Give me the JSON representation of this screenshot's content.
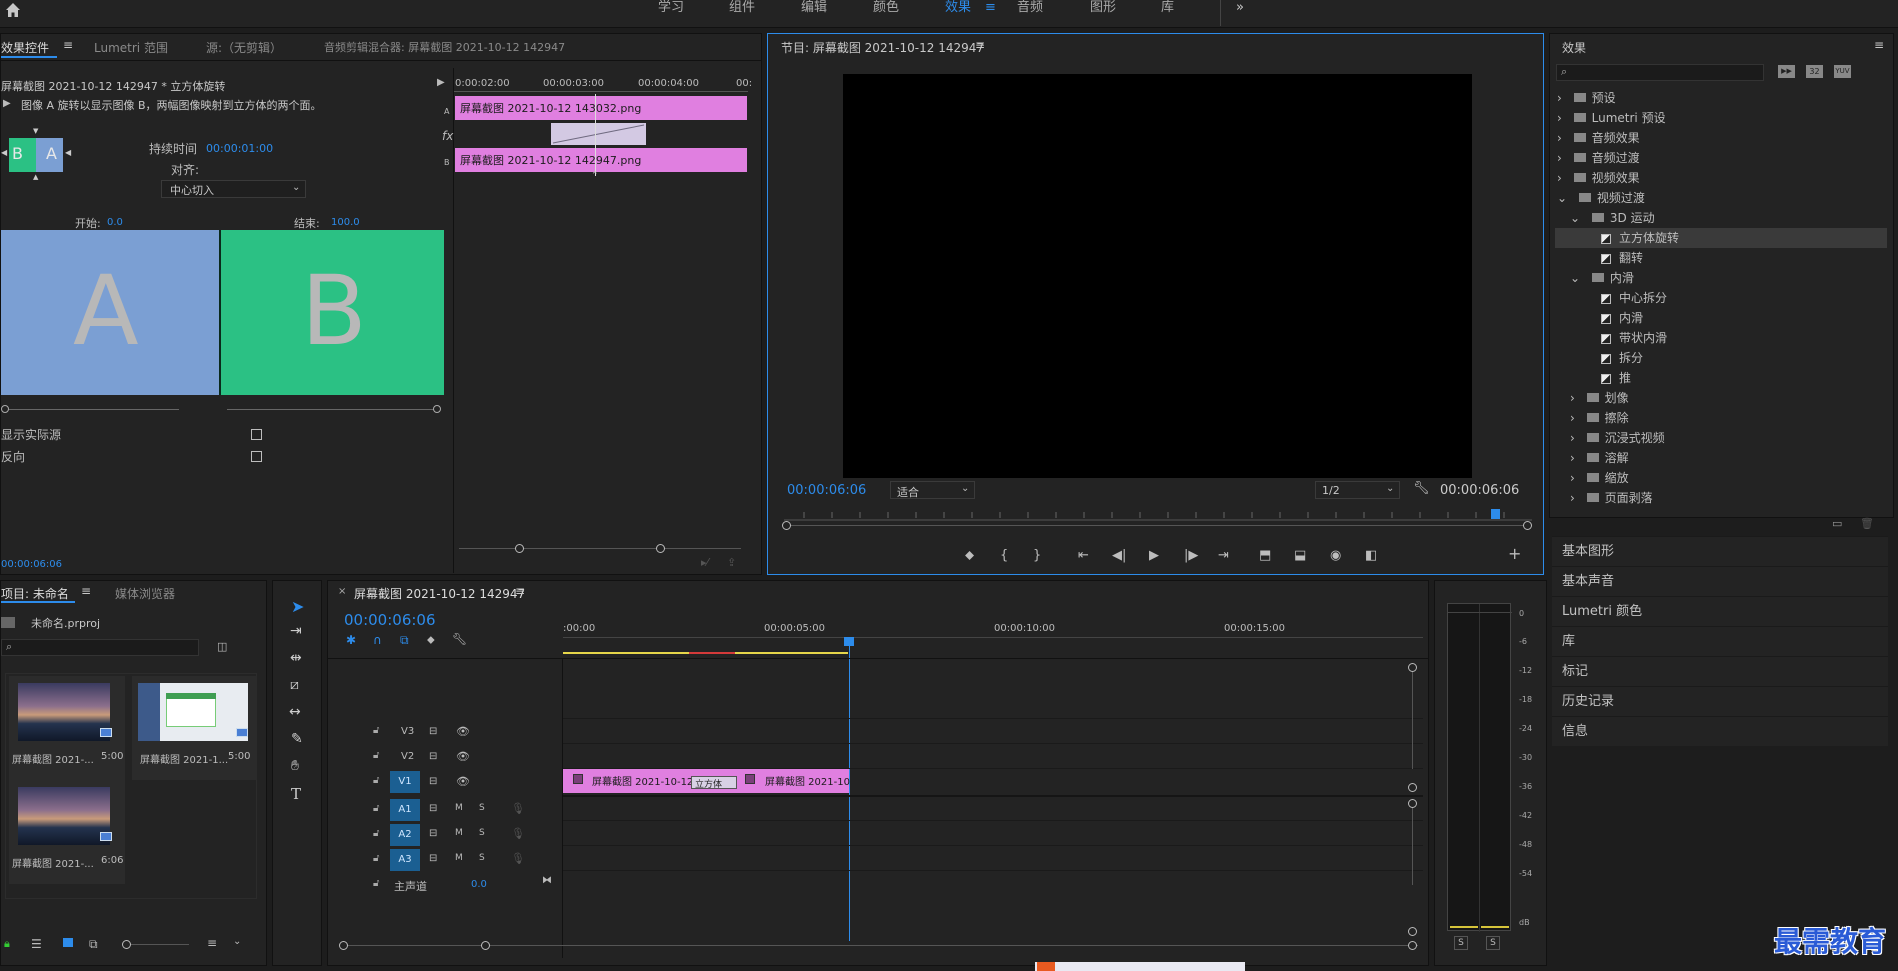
{
  "top_nav": {
    "items": [
      "学习",
      "组件",
      "编辑",
      "颜色",
      "效果",
      "音频",
      "图形",
      "库"
    ],
    "active": "效果",
    "more": "»"
  },
  "effect_controls": {
    "tabs": [
      "效果控件",
      "Lumetri 范围",
      "源:（无剪辑）",
      "音频剪辑混合器: 屏幕截图 2021-10-12 142947"
    ],
    "clip_title": "屏幕截图 2021-10-12 142947 * 立方体旋转",
    "description": "图像 A 旋转以显示图像 B，两幅图像映射到立方体的两个面。",
    "duration_label": "持续时间",
    "duration_value": "00:00:01:00",
    "align_label": "对齐:",
    "align_value": "中心切入",
    "start_label": "开始:",
    "start_value": "0.0",
    "end_label": "结束:",
    "end_value": "100.0",
    "preview_a": "A",
    "preview_b": "B",
    "thumb_a": "A",
    "thumb_b": "B",
    "show_actual_sources": "显示实际源",
    "reverse": "反向",
    "timecode": "00:00:06:06",
    "mini_times": [
      "0:00:02:00",
      "00:00:03:00",
      "00:00:04:00",
      "00:"
    ],
    "clip_a": "屏幕截图 2021-10-12 143032.png",
    "clip_b": "屏幕截图 2021-10-12 142947.png",
    "track_a": "A",
    "track_b": "B",
    "fx": "fx"
  },
  "program_monitor": {
    "title": "节目: 屏幕截图 2021-10-12 142947",
    "timecode_left": "00:00:06:06",
    "fit": "适合",
    "resolution": "1/2",
    "timecode_right": "00:00:06:06"
  },
  "effects_panel": {
    "title": "效果",
    "tree": [
      {
        "label": "预设",
        "level": 0,
        "type": "folder",
        "expanded": false
      },
      {
        "label": "Lumetri 预设",
        "level": 0,
        "type": "folder",
        "expanded": false
      },
      {
        "label": "音频效果",
        "level": 0,
        "type": "folder",
        "expanded": false
      },
      {
        "label": "音频过渡",
        "level": 0,
        "type": "folder",
        "expanded": false
      },
      {
        "label": "视频效果",
        "level": 0,
        "type": "folder",
        "expanded": false
      },
      {
        "label": "视频过渡",
        "level": 0,
        "type": "folder",
        "expanded": true
      },
      {
        "label": "3D 运动",
        "level": 1,
        "type": "folder",
        "expanded": true
      },
      {
        "label": "立方体旋转",
        "level": 2,
        "type": "effect",
        "selected": true
      },
      {
        "label": "翻转",
        "level": 2,
        "type": "effect"
      },
      {
        "label": "内滑",
        "level": 1,
        "type": "folder",
        "expanded": true
      },
      {
        "label": "中心拆分",
        "level": 2,
        "type": "effect"
      },
      {
        "label": "内滑",
        "level": 2,
        "type": "effect"
      },
      {
        "label": "带状内滑",
        "level": 2,
        "type": "effect"
      },
      {
        "label": "拆分",
        "level": 2,
        "type": "effect"
      },
      {
        "label": "推",
        "level": 2,
        "type": "effect"
      },
      {
        "label": "划像",
        "level": 1,
        "type": "folder",
        "expanded": false
      },
      {
        "label": "擦除",
        "level": 1,
        "type": "folder",
        "expanded": false
      },
      {
        "label": "沉浸式视频",
        "level": 1,
        "type": "folder",
        "expanded": false
      },
      {
        "label": "溶解",
        "level": 1,
        "type": "folder",
        "expanded": false
      },
      {
        "label": "缩放",
        "level": 1,
        "type": "folder",
        "expanded": false
      },
      {
        "label": "页面剥落",
        "level": 1,
        "type": "folder",
        "expanded": false
      }
    ],
    "sections": [
      "基本图形",
      "基本声音",
      "Lumetri 颜色",
      "库",
      "标记",
      "历史记录",
      "信息"
    ],
    "filter_badges": [
      "32",
      "YUV"
    ]
  },
  "project": {
    "tabs": [
      "项目: 未命名",
      "媒体浏览器"
    ],
    "file": "未命名.prproj",
    "items": [
      {
        "name": "屏幕截图 2021-...",
        "duration": "5:00"
      },
      {
        "name": "屏幕截图 2021-1...",
        "duration": "5:00"
      },
      {
        "name": "屏幕截图 2021-...",
        "duration": "6:06"
      }
    ]
  },
  "timeline": {
    "title": "屏幕截图 2021-10-12 142947",
    "timecode": "00:00:06:06",
    "ruler": [
      ":00:00",
      "00:00:05:00",
      "00:00:10:00",
      "00:00:15:00"
    ],
    "video_tracks": [
      "V3",
      "V2",
      "V1"
    ],
    "audio_tracks": [
      "A1",
      "A2",
      "A3"
    ],
    "m": "M",
    "s": "S",
    "master_label": "主声道",
    "master_value": "0.0",
    "clip1": "屏幕截图 2021-10-12",
    "clip2": "屏幕截图 2021-10",
    "transition": "立方体"
  },
  "meter": {
    "scale": [
      "0",
      "-6",
      "-12",
      "-18",
      "-24",
      "-30",
      "-36",
      "-42",
      "-48",
      "-54",
      "dB"
    ],
    "solo": [
      "S",
      "S"
    ]
  },
  "watermark": "最需教育",
  "colors": {
    "accent": "#2d8ceb",
    "clip": "#e07fe0",
    "track_active": "#1b5f92",
    "a_blue": "#7b9fd3",
    "b_green": "#2bc184"
  }
}
